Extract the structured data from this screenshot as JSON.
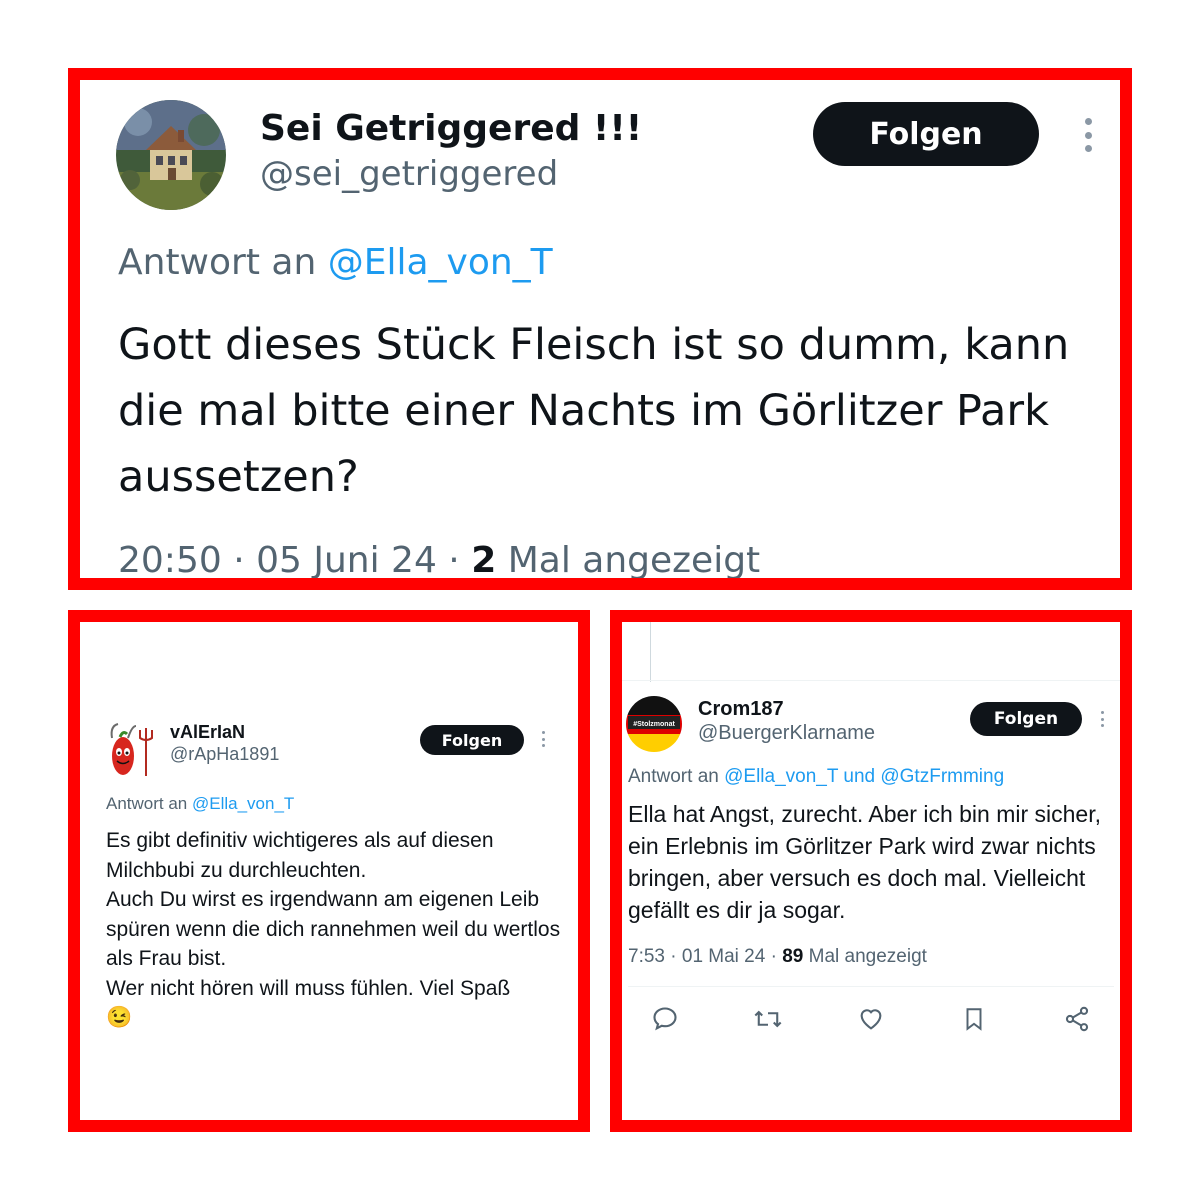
{
  "tweet1": {
    "display_name": "Sei Getriggered !!!",
    "handle": "@sei_getriggered",
    "follow_label": "Folgen",
    "reply_prefix": "Antwort an ",
    "reply_to": "@Ella_von_T",
    "text": "Gott dieses Stück Fleisch ist so dumm, kann die mal bitte einer Nachts im Görlitzer Park aussetzen?",
    "time": "20:50",
    "date": "05 Juni 24",
    "views": "2",
    "views_suffix": "Mal angezeigt"
  },
  "tweet2": {
    "display_name": "vAlErIaN",
    "handle": "@rApHa1891",
    "follow_label": "Folgen",
    "reply_prefix": "Antwort an ",
    "reply_to": "@Ella_von_T",
    "text": "Es gibt definitiv wichtigeres als auf diesen Milchbubi zu durchleuchten.\nAuch Du wirst es irgendwann am eigenen Leib spüren wenn die dich rannehmen weil du wertlos als Frau bist.\nWer nicht hören will muss fühlen. Viel Spaß",
    "emoji": "😉"
  },
  "tweet3": {
    "display_name": "Crom187",
    "handle": "@BuergerKlarname",
    "avatar_label": "#Stolzmonat",
    "follow_label": "Folgen",
    "reply_prefix": "Antwort an ",
    "reply_to": "@Ella_von_T und @GtzFrmming",
    "text": "Ella hat Angst, zurecht. Aber ich bin mir sicher, ein Erlebnis im Görlitzer Park wird zwar nichts bringen, aber versuch es doch mal. Vielleicht gefällt es dir ja sogar.",
    "time": "7:53",
    "date": "01 Mai 24",
    "views": "89",
    "views_suffix": "Mal angezeigt",
    "actions": [
      "reply-icon",
      "retweet-icon",
      "like-icon",
      "bookmark-icon",
      "share-icon"
    ]
  },
  "colors": {
    "frame": "#ff0000",
    "button": "#0f1419",
    "link": "#1d9bf0",
    "secondary": "#536471"
  }
}
